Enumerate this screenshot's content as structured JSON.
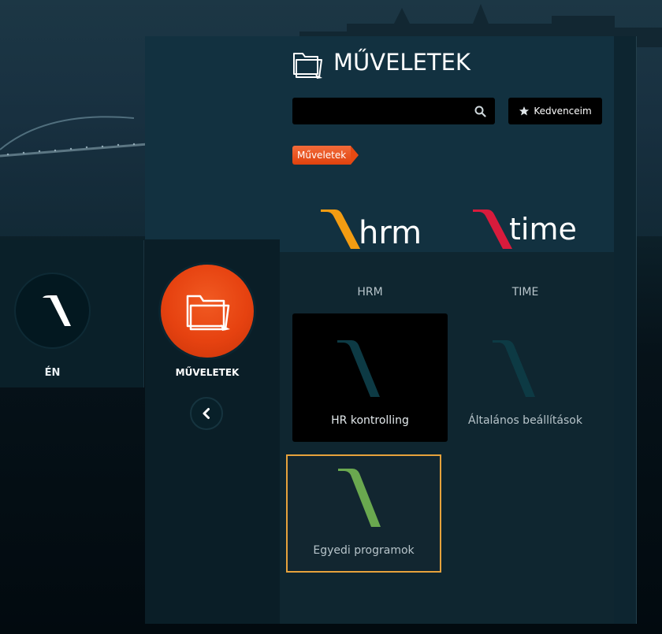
{
  "left_card": {
    "label": "ÉN"
  },
  "sidebar": {
    "label": "MŰVELETEK"
  },
  "header": {
    "title": "MŰVELETEK"
  },
  "search": {
    "value": "",
    "placeholder": ""
  },
  "favorites": {
    "label": "Kedvenceim"
  },
  "breadcrumb": {
    "label": "Műveletek"
  },
  "tiles": [
    {
      "label": "HRM",
      "logo_text": "hrm",
      "accent": "#f39c12"
    },
    {
      "label": "TIME",
      "logo_text": "time",
      "accent": "#d81b3c"
    },
    {
      "label": "HR kontrolling",
      "accent": "#0d3a44"
    },
    {
      "label": "Általános beállítások",
      "accent": "#0d3a44"
    },
    {
      "label": "Egyedi programok",
      "accent": "#6aa84f"
    }
  ],
  "colors": {
    "brand_orange": "#e64210",
    "highlight_border": "#e6a23c"
  }
}
